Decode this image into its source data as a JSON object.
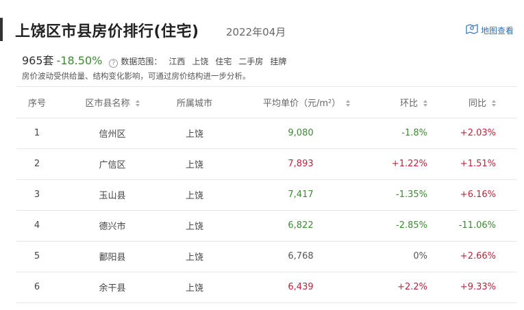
{
  "header": {
    "title": "上饶区市县房价排行(住宅)",
    "date": "2022年04月",
    "map_link": "地图查看"
  },
  "summary": {
    "count": "965套",
    "change": "-18.50%",
    "scope_label": "数据范围：",
    "scope_items": [
      "江西",
      "上饶",
      "住宅",
      "二手房",
      "挂牌"
    ],
    "note": "房价波动受供给量、结构变化影响，可通过房价结构进一步分析。"
  },
  "table": {
    "headers": [
      "序号",
      "区市县名称",
      "所属城市",
      "平均单价（元/m²）",
      "环比",
      "同比"
    ],
    "rows": [
      {
        "no": "1",
        "name": "信州区",
        "city": "上饶",
        "price": "9,080",
        "price_color": "green",
        "mom": "-1.8%",
        "mom_color": "green",
        "yoy": "+2.03%",
        "yoy_color": "red"
      },
      {
        "no": "2",
        "name": "广信区",
        "city": "上饶",
        "price": "7,893",
        "price_color": "red",
        "mom": "+1.22%",
        "mom_color": "red",
        "yoy": "+1.51%",
        "yoy_color": "red"
      },
      {
        "no": "3",
        "name": "玉山县",
        "city": "上饶",
        "price": "7,417",
        "price_color": "green",
        "mom": "-1.35%",
        "mom_color": "green",
        "yoy": "+6.16%",
        "yoy_color": "red"
      },
      {
        "no": "4",
        "name": "德兴市",
        "city": "上饶",
        "price": "6,822",
        "price_color": "green",
        "mom": "-2.85%",
        "mom_color": "green",
        "yoy": "-11.06%",
        "yoy_color": "green"
      },
      {
        "no": "5",
        "name": "鄱阳县",
        "city": "上饶",
        "price": "6,768",
        "price_color": "gray",
        "mom": "0%",
        "mom_color": "gray",
        "yoy": "+2.66%",
        "yoy_color": "red"
      },
      {
        "no": "6",
        "name": "余干县",
        "city": "上饶",
        "price": "6,439",
        "price_color": "red",
        "mom": "+2.2%",
        "mom_color": "red",
        "yoy": "+9.33%",
        "yoy_color": "red"
      }
    ]
  },
  "colors": {
    "green": "#3b8a2f",
    "red": "#c0213b",
    "link": "#2f6fb5"
  }
}
